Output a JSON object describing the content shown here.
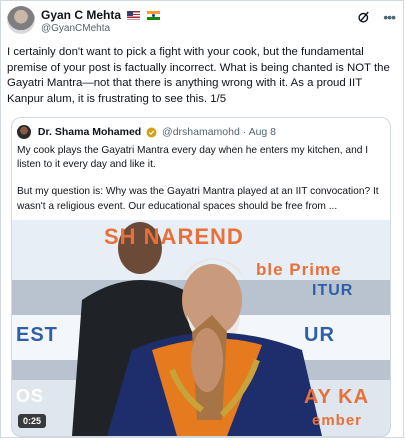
{
  "author": {
    "name": "Gyan C Mehta",
    "handle": "@GyanCMehta",
    "flags": [
      "us-flag-icon",
      "india-flag-icon"
    ]
  },
  "tweet": {
    "text": "I certainly don't want to pick a fight with your cook, but the fundamental premise of your post is factually incorrect. What is being chanted is NOT the Gayatri Mantra—not that there is anything wrong with it. As a proud IIT Kanpur alum, it is frustrating to see this. 1/5"
  },
  "quote": {
    "name": "Dr. Shama Mohamed",
    "handle": "@drshamamohd",
    "date": "· Aug 8",
    "paragraph1": "My cook plays the Gayatri Mantra every day when he enters my kitchen, and I listen to it every day and like it.",
    "paragraph2": "But my question is: Why was the Gayatri Mantra played at an IIT convocation? It wasn't a religious event. Our educational spaces should be free from ...",
    "video": {
      "duration": "0:25",
      "banner_top": "SH NAREND",
      "banner_mid": "ble Prime",
      "banner_left": "EST",
      "banner_right": "UR",
      "banner_right2": "ITUR",
      "banner_bottom_left": "OS",
      "banner_bottom_right": "AY KA",
      "banner_bottom": "ember"
    }
  },
  "colors": {
    "text": "#0f1419",
    "secondary": "#536471",
    "verified": "#d4a017",
    "banner_orange": "#e8703a",
    "banner_blue": "#2e5fa8"
  }
}
